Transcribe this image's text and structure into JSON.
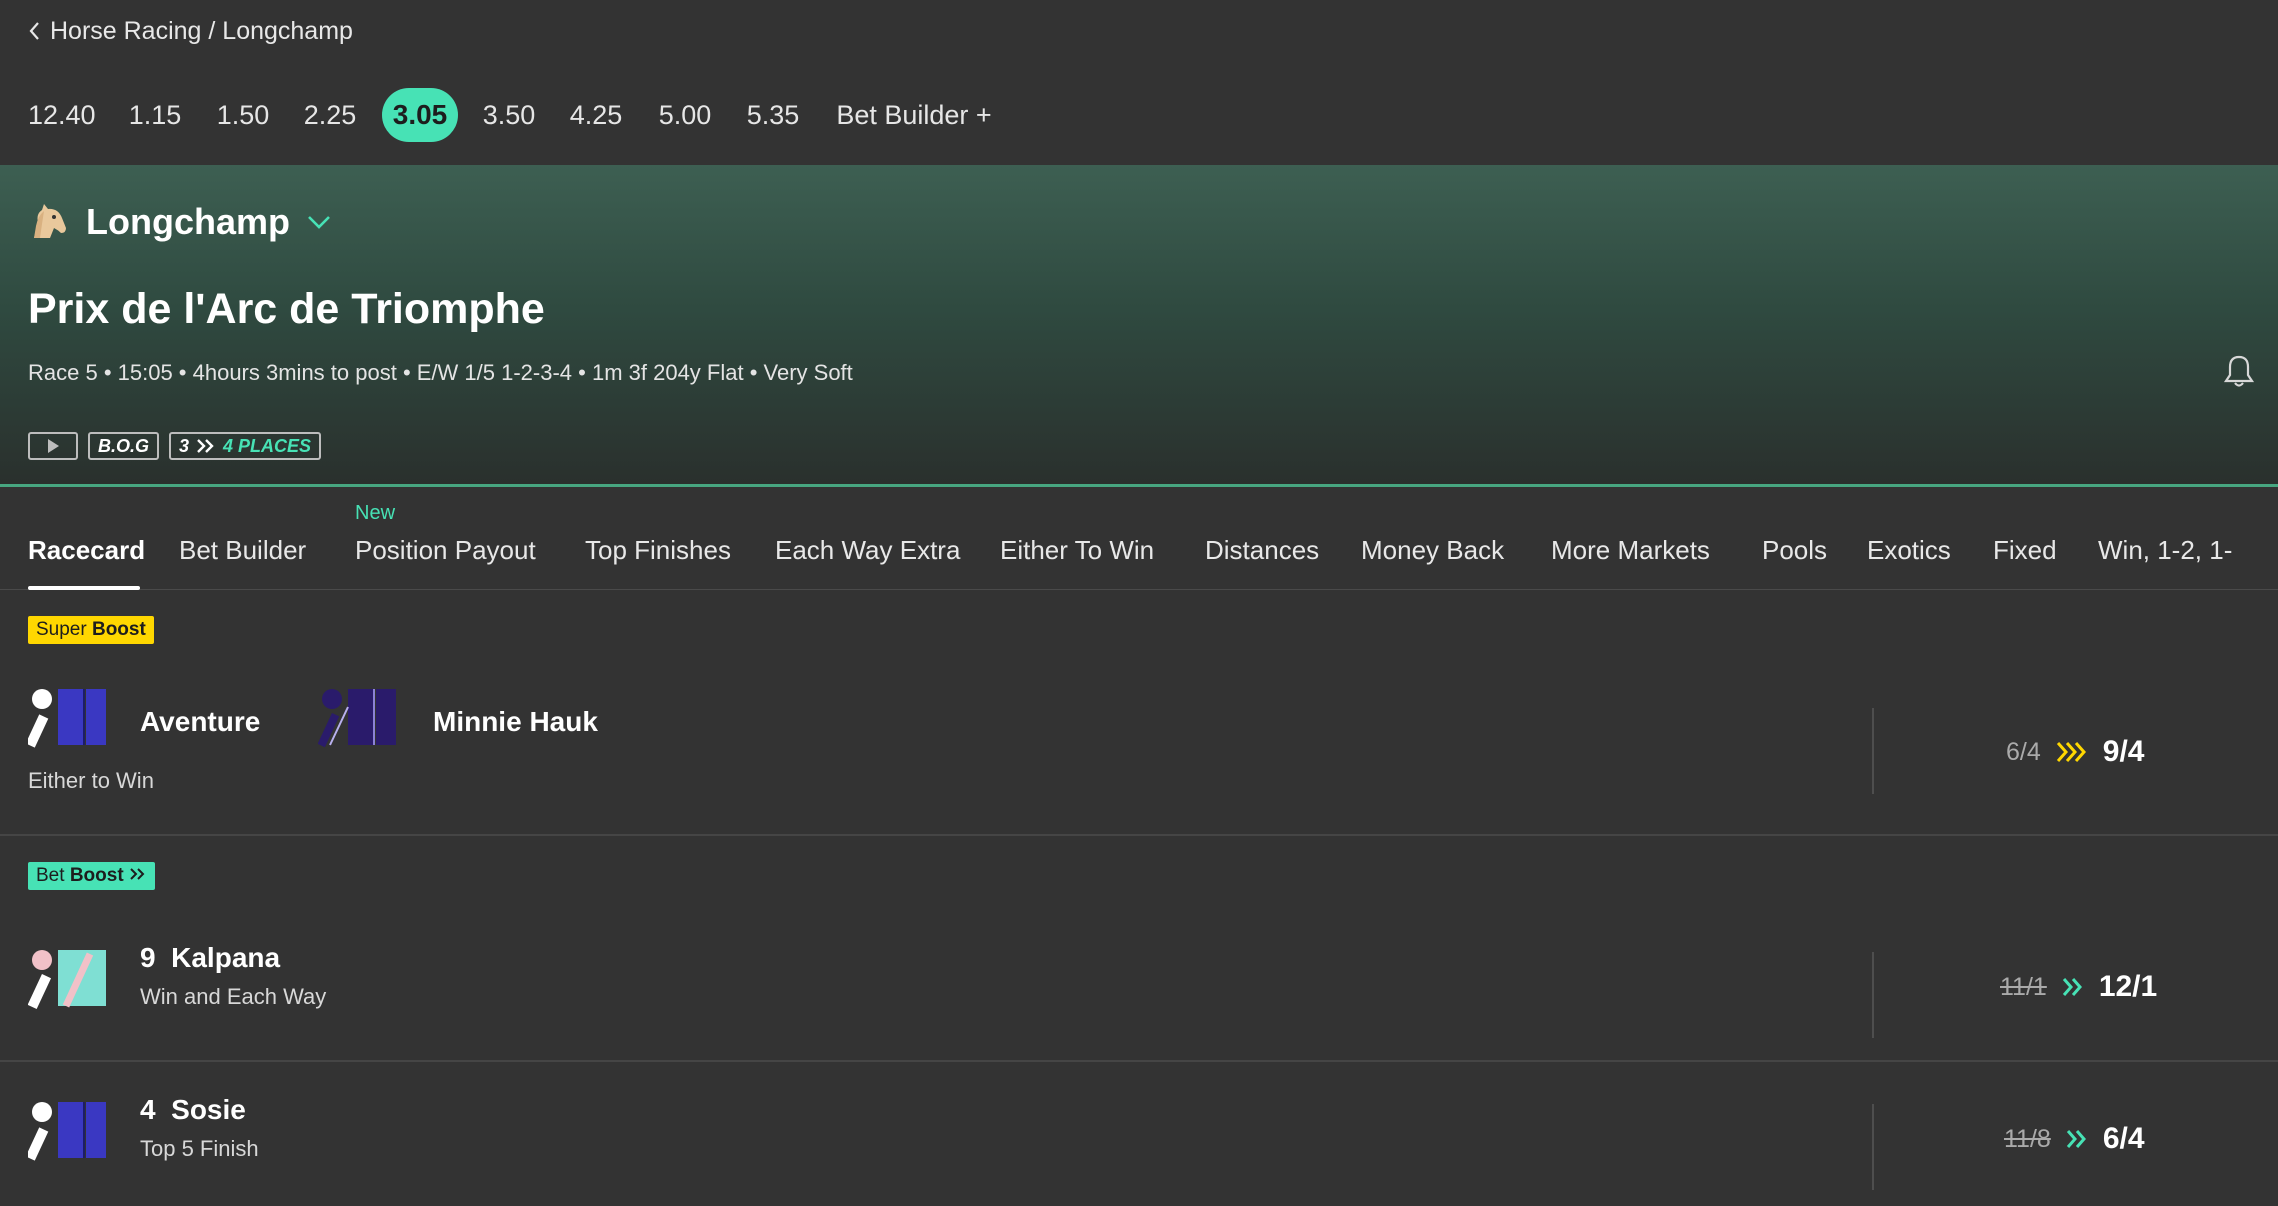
{
  "breadcrumb": {
    "text": "Horse Racing / Longchamp"
  },
  "times": {
    "items": [
      "12.40",
      "1.15",
      "1.50",
      "2.25",
      "3.05",
      "3.50",
      "4.25",
      "5.00",
      "5.35",
      "Bet Builder +"
    ],
    "active": "3.05"
  },
  "hero": {
    "course": "Longchamp",
    "race_title": "Prix de l'Arc de Triomphe",
    "race_meta": "Race 5 • 15:05 • 4hours 3mins to post • E/W 1/5 1-2-3-4 • 1m 3f 204y Flat • Very Soft",
    "badges": {
      "bog": "B.O.G",
      "places_from": "3",
      "places_to": "4 PLACES"
    }
  },
  "tabs": {
    "new_label": "New",
    "items": [
      "Racecard",
      "Bet Builder",
      "Position Payout",
      "Top Finishes",
      "Each Way Extra",
      "Either To Win",
      "Distances",
      "Money Back",
      "More Markets",
      "Pools",
      "Exotics",
      "Fixed",
      "Win, 1-2, 1-"
    ],
    "active": "Racecard"
  },
  "super_boost": {
    "tag_prefix": "Super",
    "tag_bold": "Boost",
    "runner_1": "Aventure",
    "runner_2": "Minnie Hauk",
    "market": "Either to Win",
    "old_odds": "6/4",
    "new_odds": "9/4"
  },
  "bet_boost": {
    "tag_prefix": "Bet",
    "tag_bold": "Boost",
    "items": [
      {
        "number": "9",
        "name": "Kalpana",
        "market": "Win and Each Way",
        "old_odds": "11/1",
        "new_odds": "12/1"
      },
      {
        "number": "4",
        "name": "Sosie",
        "market": "Top 5 Finish",
        "old_odds": "11/8",
        "new_odds": "6/4"
      }
    ]
  },
  "colors": {
    "accent": "#47e2b5",
    "super_boost": "#ffd700",
    "background": "#333333"
  },
  "icons": [
    "chevron-left-icon",
    "horse-head-icon",
    "chevron-down-icon",
    "bell-icon",
    "play-icon",
    "double-chevron-icon"
  ]
}
